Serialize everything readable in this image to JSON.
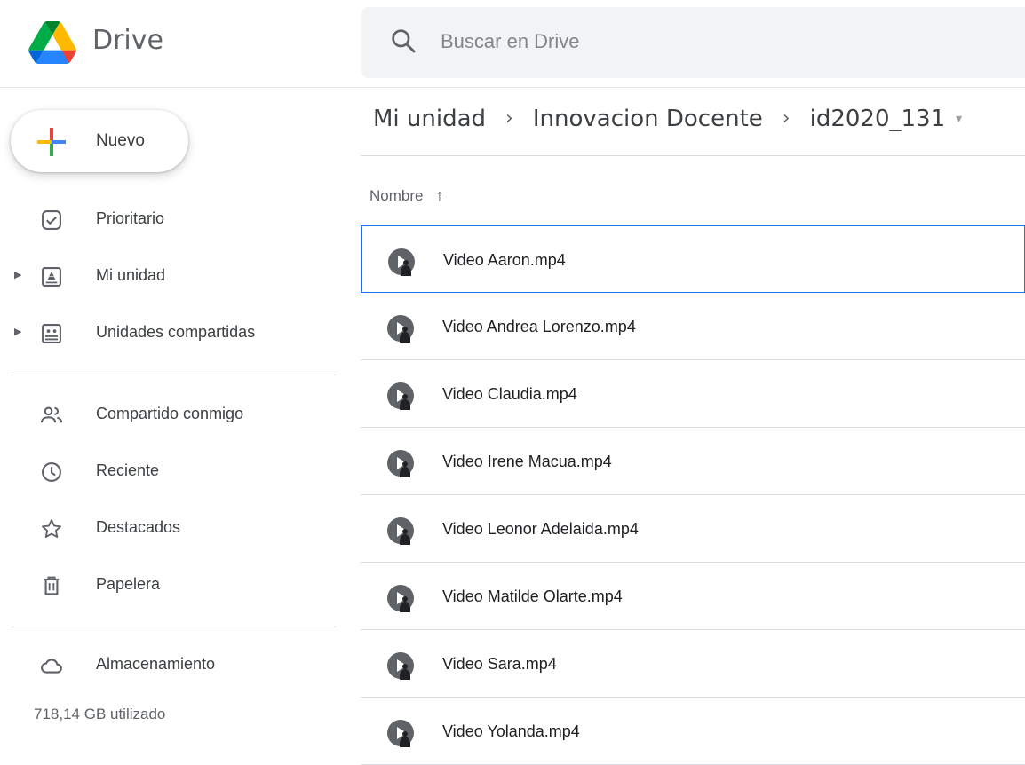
{
  "app": {
    "brand": "Drive"
  },
  "search": {
    "placeholder": "Buscar en Drive"
  },
  "new_button": {
    "label": "Nuevo"
  },
  "sidebar": {
    "items": [
      {
        "label": "Prioritario",
        "icon": "priority-check-icon",
        "expandable": false
      },
      {
        "label": "Mi unidad",
        "icon": "my-drive-icon",
        "expandable": true
      },
      {
        "label": "Unidades compartidas",
        "icon": "shared-drives-icon",
        "expandable": true
      },
      {
        "label": "Compartido conmigo",
        "icon": "people-icon",
        "expandable": false
      },
      {
        "label": "Reciente",
        "icon": "clock-icon",
        "expandable": false
      },
      {
        "label": "Destacados",
        "icon": "star-icon",
        "expandable": false
      },
      {
        "label": "Papelera",
        "icon": "trash-icon",
        "expandable": false
      },
      {
        "label": "Almacenamiento",
        "icon": "cloud-icon",
        "expandable": false
      }
    ],
    "storage_used": "718,14 GB utilizado"
  },
  "breadcrumb": {
    "items": [
      "Mi unidad",
      "Innovacion Docente",
      "id2020_131"
    ],
    "separator": "›",
    "dropdown_glyph": "▾"
  },
  "list": {
    "column_header": "Nombre",
    "sort_glyph": "↑",
    "files": [
      {
        "name": "Video Aaron.mp4",
        "selected": true
      },
      {
        "name": "Video Andrea Lorenzo.mp4",
        "selected": false
      },
      {
        "name": "Video Claudia.mp4",
        "selected": false
      },
      {
        "name": "Video Irene Macua.mp4",
        "selected": false
      },
      {
        "name": "Video Leonor Adelaida.mp4",
        "selected": false
      },
      {
        "name": "Video Matilde Olarte.mp4",
        "selected": false
      },
      {
        "name": "Video Sara.mp4",
        "selected": false
      },
      {
        "name": "Video Yolanda.mp4",
        "selected": false
      }
    ]
  },
  "colors": {
    "accent": "#1a73e8",
    "text": "#3c4043",
    "muted": "#5f6368",
    "divider": "#dadce0",
    "search_bg": "#f1f3f4"
  }
}
